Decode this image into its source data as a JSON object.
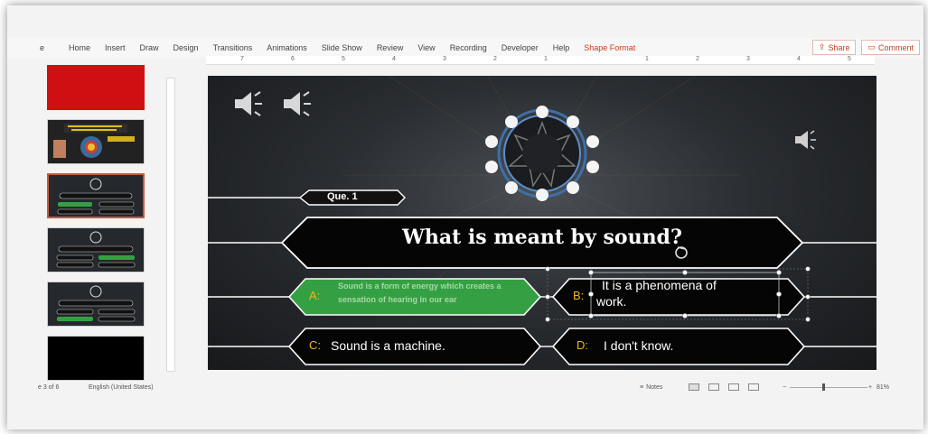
{
  "ribbon": {
    "tabs": [
      "Home",
      "Insert",
      "Draw",
      "Design",
      "Transitions",
      "Animations",
      "Slide Show",
      "Review",
      "View",
      "Recording",
      "Developer",
      "Help"
    ],
    "active_tab": "Shape Format",
    "file_fragment": "e",
    "share_label": "Share",
    "comment_label": "Comment"
  },
  "ruler": {
    "ticks": [
      "7",
      "6",
      "5",
      "4",
      "3",
      "2",
      "1",
      "1",
      "2",
      "3",
      "4",
      "5"
    ]
  },
  "slide": {
    "que_label": "Que. 1",
    "question": "What is meant by sound?",
    "options": {
      "a": {
        "letter": "A:",
        "text": "Sound is a form of energy which creates a sensation of hearing in our ear"
      },
      "b": {
        "letter": "B:",
        "text_line1": "It is a phenomena of",
        "text_line2": "work."
      },
      "c": {
        "letter": "C:",
        "text": "Sound is  a machine."
      },
      "d": {
        "letter": "D:",
        "text": "I don't know."
      }
    }
  },
  "status": {
    "slide_number": "e 3 of 6",
    "language": "English (United States)",
    "notes_label": "Notes",
    "zoom": "81%"
  },
  "colors": {
    "accent": "#c43e1c",
    "correct_answer": "#35a043",
    "option_letter": "#f0b41c",
    "slide_bg": "#1d2023"
  },
  "icons": [
    "speaker-icon",
    "lifeline-clock-icon",
    "share-icon",
    "comment-icon",
    "notes-icon"
  ]
}
